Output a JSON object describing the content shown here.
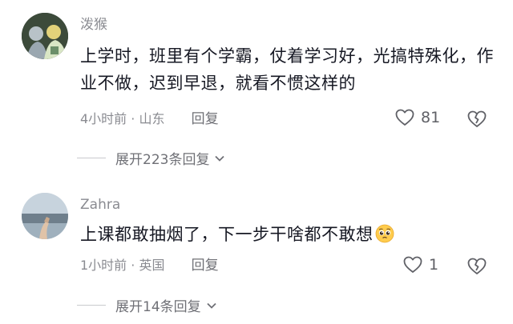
{
  "comments": [
    {
      "username": "泼猴",
      "text": "上学时，班里有个学霸，仗着学习好，光搞特殊化，作业不做，迟到早退，就看不惯这样的",
      "time": "4小时前",
      "separator": "·",
      "location": "山东",
      "reply_label": "回复",
      "likes": "81",
      "expand_label": "展开223条回复",
      "icons": {
        "like": "heart-icon",
        "dislike": "broken-heart-icon",
        "expand": "chevron-down-icon"
      }
    },
    {
      "username": "Zahra",
      "text": "上课都敢抽烟了，下一步干啥都不敢想",
      "emoji": "pleading-face-emoji",
      "time": "1小时前",
      "separator": "·",
      "location": "英国",
      "reply_label": "回复",
      "likes": "1",
      "expand_label": "展开14条回复",
      "icons": {
        "like": "heart-icon",
        "dislike": "broken-heart-icon",
        "expand": "chevron-down-icon"
      }
    }
  ],
  "colors": {
    "text": "#161823",
    "secondary": "#8a8b91",
    "icon": "#5f6066"
  }
}
